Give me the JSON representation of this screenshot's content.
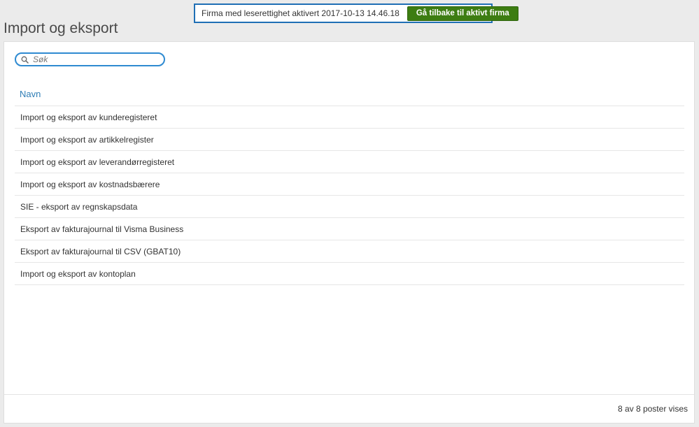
{
  "page": {
    "title": "Import og eksport"
  },
  "banner": {
    "text": "Firma med leserettighet aktivert 2017-10-13 14.46.18",
    "button_label": "Gå tilbake til aktivt firma",
    "border_color": "#1f6fb5",
    "button_color": "#3d7d12"
  },
  "search": {
    "placeholder": "Søk",
    "icon": "search-icon"
  },
  "table": {
    "column_header": "Navn",
    "rows": [
      "Import og eksport av kunderegisteret",
      "Import og eksport av artikkelregister",
      "Import og eksport av leverandørregisteret",
      "Import og eksport av kostnadsbærere",
      "SIE - eksport av regnskapsdata",
      "Eksport av fakturajournal til Visma Business",
      "Eksport av fakturajournal til CSV (GBAT10)",
      "Import og eksport av kontoplan"
    ]
  },
  "footer": {
    "count_text": "8 av 8 poster vises"
  }
}
